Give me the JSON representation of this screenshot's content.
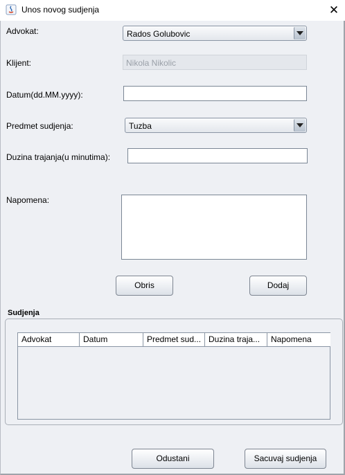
{
  "window": {
    "title": "Unos novog sudjenja",
    "close_glyph": "✕"
  },
  "form": {
    "advokat": {
      "label": "Advokat:",
      "value": "Rados Golubovic"
    },
    "klijent": {
      "label": "Klijent:",
      "value": "Nikola Nikolic"
    },
    "datum": {
      "label": "Datum(dd.MM.yyyy):",
      "value": ""
    },
    "predmet": {
      "label": "Predmet sudjenja:",
      "value": "Tuzba"
    },
    "trajanje": {
      "label": "Duzina trajanja(u minutima):",
      "value": ""
    },
    "napomena": {
      "label": "Napomena:",
      "value": ""
    }
  },
  "buttons": {
    "obrisi": "Obris",
    "dodaj": "Dodaj",
    "odustani": "Odustani",
    "sacuvaj": "Sacuvaj sudjenja"
  },
  "table": {
    "title": "Sudjenja",
    "columns": [
      "Advokat",
      "Datum",
      "Predmet sud...",
      "Duzina traja...",
      "Napomena"
    ],
    "rows": []
  },
  "colors": {
    "background": "#eef0f4",
    "border": "#8a95a4"
  }
}
